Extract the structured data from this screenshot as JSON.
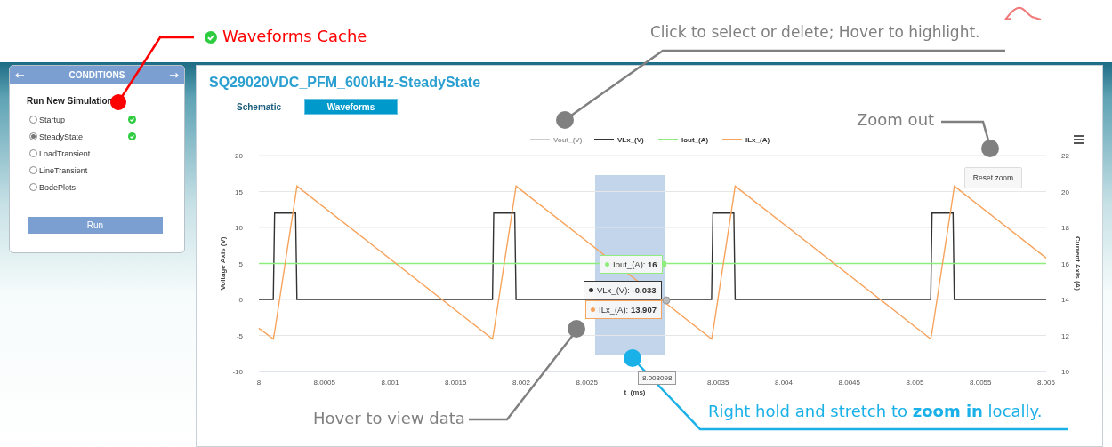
{
  "callouts": [
    {
      "kind": "status",
      "text": "Waveforms Cache",
      "color": "#ff0000"
    },
    {
      "kind": "note",
      "text": "Click to select or delete; Hover to highlight.",
      "color": "#7f7f7f"
    },
    {
      "kind": "note",
      "text": "Zoom out",
      "color": "#7f7f7f"
    },
    {
      "kind": "note",
      "text": "Hover to view data",
      "color": "#7f7f7f"
    },
    {
      "kind": "note",
      "text": "Right hold and stretch to **zoom in** locally.",
      "color": "#1ab0e8"
    }
  ],
  "sidebar": {
    "prev": "←",
    "title": "CONDITIONS",
    "next": "→",
    "section": "Run New Simulation",
    "items": [
      {
        "label": "Startup",
        "selected": false,
        "cached": true
      },
      {
        "label": "SteadyState",
        "selected": true,
        "cached": true
      },
      {
        "label": "LoadTransient",
        "selected": false,
        "cached": false
      },
      {
        "label": "LineTransient",
        "selected": false,
        "cached": false
      },
      {
        "label": "BodePlots",
        "selected": false,
        "cached": false
      }
    ],
    "button": "Run"
  },
  "main": {
    "title": "SQ29020VDC_PFM_600kHz-SteadyState",
    "tabs": [
      {
        "label": "Schematic",
        "selected": false
      },
      {
        "label": "Waveforms",
        "selected": true
      }
    ],
    "reset_button": "Reset zoom",
    "hidden_series": [
      {
        "name": "Vout_(V)",
        "color": "#cccccc"
      }
    ],
    "tooltips": [
      {
        "label": "Iout_(A): **16**",
        "color": "#90ed7d"
      },
      {
        "label": "VLx_(V): **-0.033**",
        "color": "#333333"
      },
      {
        "label": "ILx_(A): **13.907**",
        "color": "#f7a35c"
      }
    ],
    "x_tooltip": "8.003098",
    "chart_data": {
      "type": "line",
      "grid": true,
      "legend": true,
      "xlabel": "t_(ms)",
      "ylabel": "Voltage Axis (V)",
      "y2label": "Current Axis (A)",
      "xlim": [
        8,
        8.006
      ],
      "ylim": [
        -10,
        20
      ],
      "y2lim": [
        10,
        22
      ],
      "xticks": [
        8,
        8.0005,
        8.001,
        8.0015,
        8.002,
        8.0025,
        8.0035,
        8.004,
        8.0045,
        8.005,
        8.0055,
        8.006
      ],
      "yticks": [
        -10,
        -5,
        0,
        5,
        10,
        15,
        20
      ],
      "y2ticks": [
        10,
        12,
        14,
        16,
        18,
        20,
        22
      ],
      "x": [
        8,
        8.00011,
        8.00012,
        8.00028,
        8.00029,
        8.00178,
        8.00179,
        8.00195,
        8.00196,
        8.00345,
        8.00346,
        8.00362,
        8.00363,
        8.00512,
        8.00513,
        8.00529,
        8.0053,
        8.006
      ],
      "series": [
        {
          "name": "VLx_(V)",
          "color": "#333333",
          "values": [
            0,
            0,
            12,
            12,
            0,
            0,
            12,
            12,
            0,
            0,
            12,
            12,
            0,
            0,
            12,
            12,
            0,
            0
          ]
        },
        {
          "name": "Iout_(A)",
          "color": "#90ed7d",
          "axis": "y2",
          "values": [
            16,
            16,
            16,
            16,
            16,
            16,
            16,
            16,
            16,
            16,
            16,
            16,
            16,
            16,
            16,
            16,
            16,
            16
          ]
        },
        {
          "name": "ILx_(A)",
          "color": "#f7a35c",
          "axis": "y2",
          "values": [
            12.4,
            11.8,
            12.2,
            19.8,
            20.3,
            11.8,
            12.2,
            19.8,
            20.3,
            11.8,
            12.2,
            19.8,
            20.3,
            11.8,
            12.2,
            19.8,
            20.3,
            16.3
          ]
        }
      ]
    }
  }
}
